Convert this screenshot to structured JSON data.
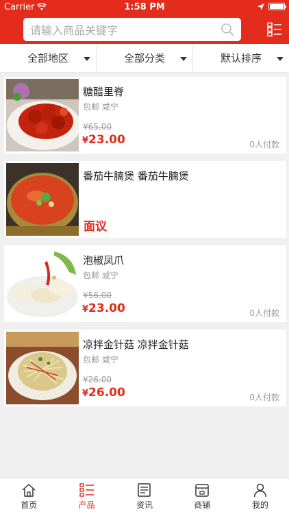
{
  "status": {
    "carrier": "Carrier",
    "time": "1:58 PM"
  },
  "search": {
    "placeholder": "请输入商品关键字",
    "icon": "search-icon"
  },
  "filters": [
    {
      "label": "全部地区"
    },
    {
      "label": "全部分类"
    },
    {
      "label": "默认排序"
    }
  ],
  "products": [
    {
      "title": "糖醋里脊",
      "shipping": "包邮",
      "city": "咸宁",
      "old_price": "¥65.00",
      "currency": "¥",
      "price": "23.00",
      "sold": "0人付款"
    },
    {
      "title": "番茄牛腩煲 番茄牛腩煲",
      "price_text": "面议"
    },
    {
      "title": "泡椒凤爪",
      "shipping": "包邮",
      "city": "咸宁",
      "old_price": "¥56.00",
      "currency": "¥",
      "price": "23.00",
      "sold": "0人付款"
    },
    {
      "title": "凉拌金针菇 凉拌金针菇",
      "shipping": "包邮",
      "city": "咸宁",
      "old_price": "¥26.00",
      "currency": "¥",
      "price": "26.00",
      "sold": "0人付款"
    }
  ],
  "tabs": [
    {
      "label": "首页",
      "icon": "home-icon"
    },
    {
      "label": "产品",
      "icon": "product-list-icon",
      "active": true
    },
    {
      "label": "资讯",
      "icon": "news-icon"
    },
    {
      "label": "商铺",
      "icon": "shop-icon"
    },
    {
      "label": "我的",
      "icon": "user-icon"
    }
  ],
  "colors": {
    "brand": "#e32c1b",
    "background": "#f0f0f0"
  }
}
